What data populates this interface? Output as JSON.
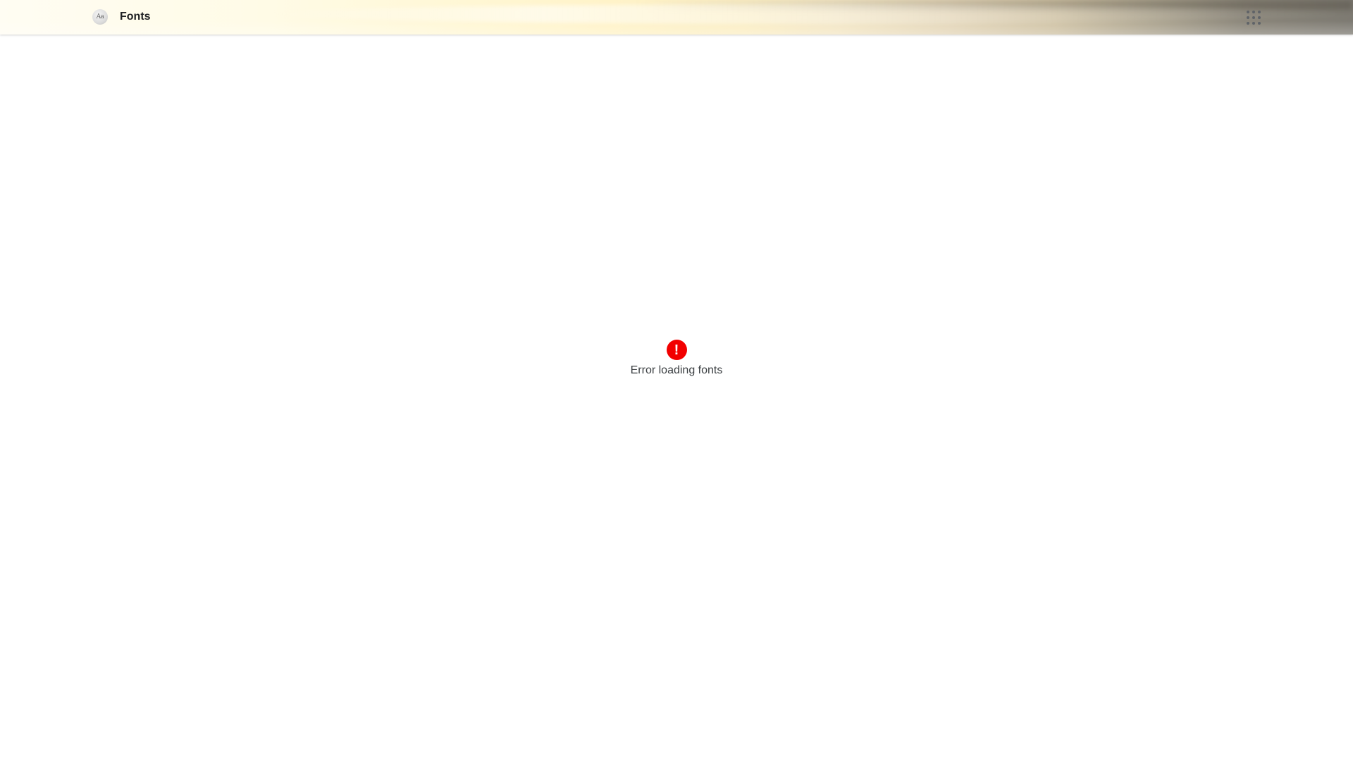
{
  "header": {
    "logo_text": "Aa",
    "title": "Fonts",
    "apps_icon": "apps-grid-icon"
  },
  "main": {
    "error_icon_symbol": "!",
    "error_message": "Error loading fonts",
    "error_color": "#f20000"
  }
}
